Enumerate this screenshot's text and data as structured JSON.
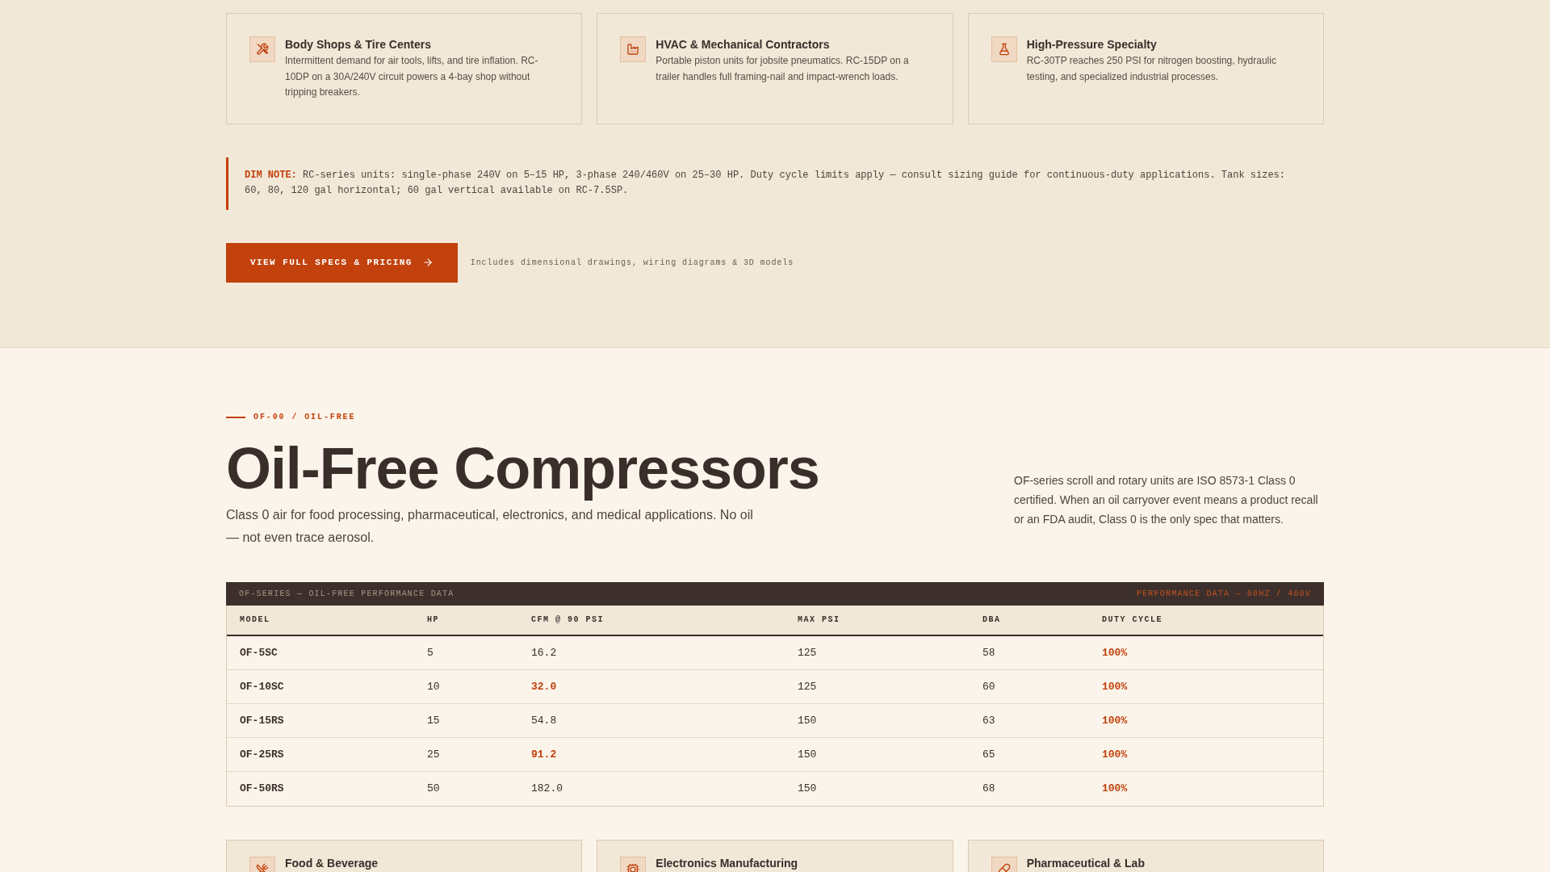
{
  "use_cases": [
    {
      "title": "Body Shops & Tire Centers",
      "description": "Intermittent demand for air tools, lifts, and tire inflation. RC-10DP on a 30A/240V circuit powers a 4-bay shop without tripping breakers."
    },
    {
      "title": "HVAC & Mechanical Contractors",
      "description": "Portable piston units for jobsite pneumatics. RC-15DP on a trailer handles full framing-nail and impact-wrench loads."
    },
    {
      "title": "High-Pressure Specialty",
      "description": "RC-30TP reaches 250 PSI for nitrogen boosting, hydraulic testing, and specialized industrial processes."
    }
  ],
  "dim_note": {
    "label": "DIM NOTE:",
    "text": "RC-series units: single-phase 240V on 5–15 HP, 3-phase 240/460V on 25–30 HP. Duty cycle limits apply — consult sizing guide for continuous-duty applications. Tank sizes: 60, 80, 120 gal horizontal; 60 gal vertical available on RC-7.5SP."
  },
  "cta": {
    "button": "VIEW FULL SPECS & PRICING",
    "caption": "Includes dimensional drawings, wiring diagrams & 3D models"
  },
  "section": {
    "eyebrow": "OF-00 / OIL-FREE",
    "title": "Oil-Free Compressors",
    "subtitle": "Class 0 air for food processing, pharmaceutical, electronics, and medical applications. No oil — not even trace aerosol.",
    "aside": "OF-series scroll and rotary units are ISO 8573-1 Class 0 certified. When an oil carryover event means a product recall or an FDA audit, Class 0 is the only spec that matters."
  },
  "table": {
    "title": "OF-SERIES — OIL-FREE PERFORMANCE DATA",
    "note": "PERFORMANCE DATA — 60HZ / 460V",
    "columns": [
      "MODEL",
      "HP",
      "CFM @ 90 PSI",
      "MAX PSI",
      "DBA",
      "DUTY CYCLE"
    ],
    "rows": [
      {
        "cells": [
          {
            "text": "OF-5SC",
            "highlight": false
          },
          {
            "text": "5",
            "highlight": false
          },
          {
            "text": "16.2",
            "highlight": false
          },
          {
            "text": "125",
            "highlight": false
          },
          {
            "text": "58",
            "highlight": false
          },
          {
            "text": "100%",
            "highlight": true
          }
        ]
      },
      {
        "cells": [
          {
            "text": "OF-10SC",
            "highlight": false
          },
          {
            "text": "10",
            "highlight": false
          },
          {
            "text": "32.0",
            "highlight": true
          },
          {
            "text": "125",
            "highlight": false
          },
          {
            "text": "60",
            "highlight": false
          },
          {
            "text": "100%",
            "highlight": true
          }
        ]
      },
      {
        "cells": [
          {
            "text": "OF-15RS",
            "highlight": false
          },
          {
            "text": "15",
            "highlight": false
          },
          {
            "text": "54.8",
            "highlight": false
          },
          {
            "text": "150",
            "highlight": false
          },
          {
            "text": "63",
            "highlight": false
          },
          {
            "text": "100%",
            "highlight": true
          }
        ]
      },
      {
        "cells": [
          {
            "text": "OF-25RS",
            "highlight": false
          },
          {
            "text": "25",
            "highlight": false
          },
          {
            "text": "91.2",
            "highlight": true
          },
          {
            "text": "150",
            "highlight": false
          },
          {
            "text": "65",
            "highlight": false
          },
          {
            "text": "100%",
            "highlight": true
          }
        ]
      },
      {
        "cells": [
          {
            "text": "OF-50RS",
            "highlight": false
          },
          {
            "text": "50",
            "highlight": false
          },
          {
            "text": "182.0",
            "highlight": false
          },
          {
            "text": "150",
            "highlight": false
          },
          {
            "text": "68",
            "highlight": false
          },
          {
            "text": "100%",
            "highlight": true
          }
        ]
      }
    ]
  },
  "applications": [
    {
      "title": "Food & Beverage"
    },
    {
      "title": "Electronics Manufacturing"
    },
    {
      "title": "Pharmaceutical & Lab"
    }
  ]
}
